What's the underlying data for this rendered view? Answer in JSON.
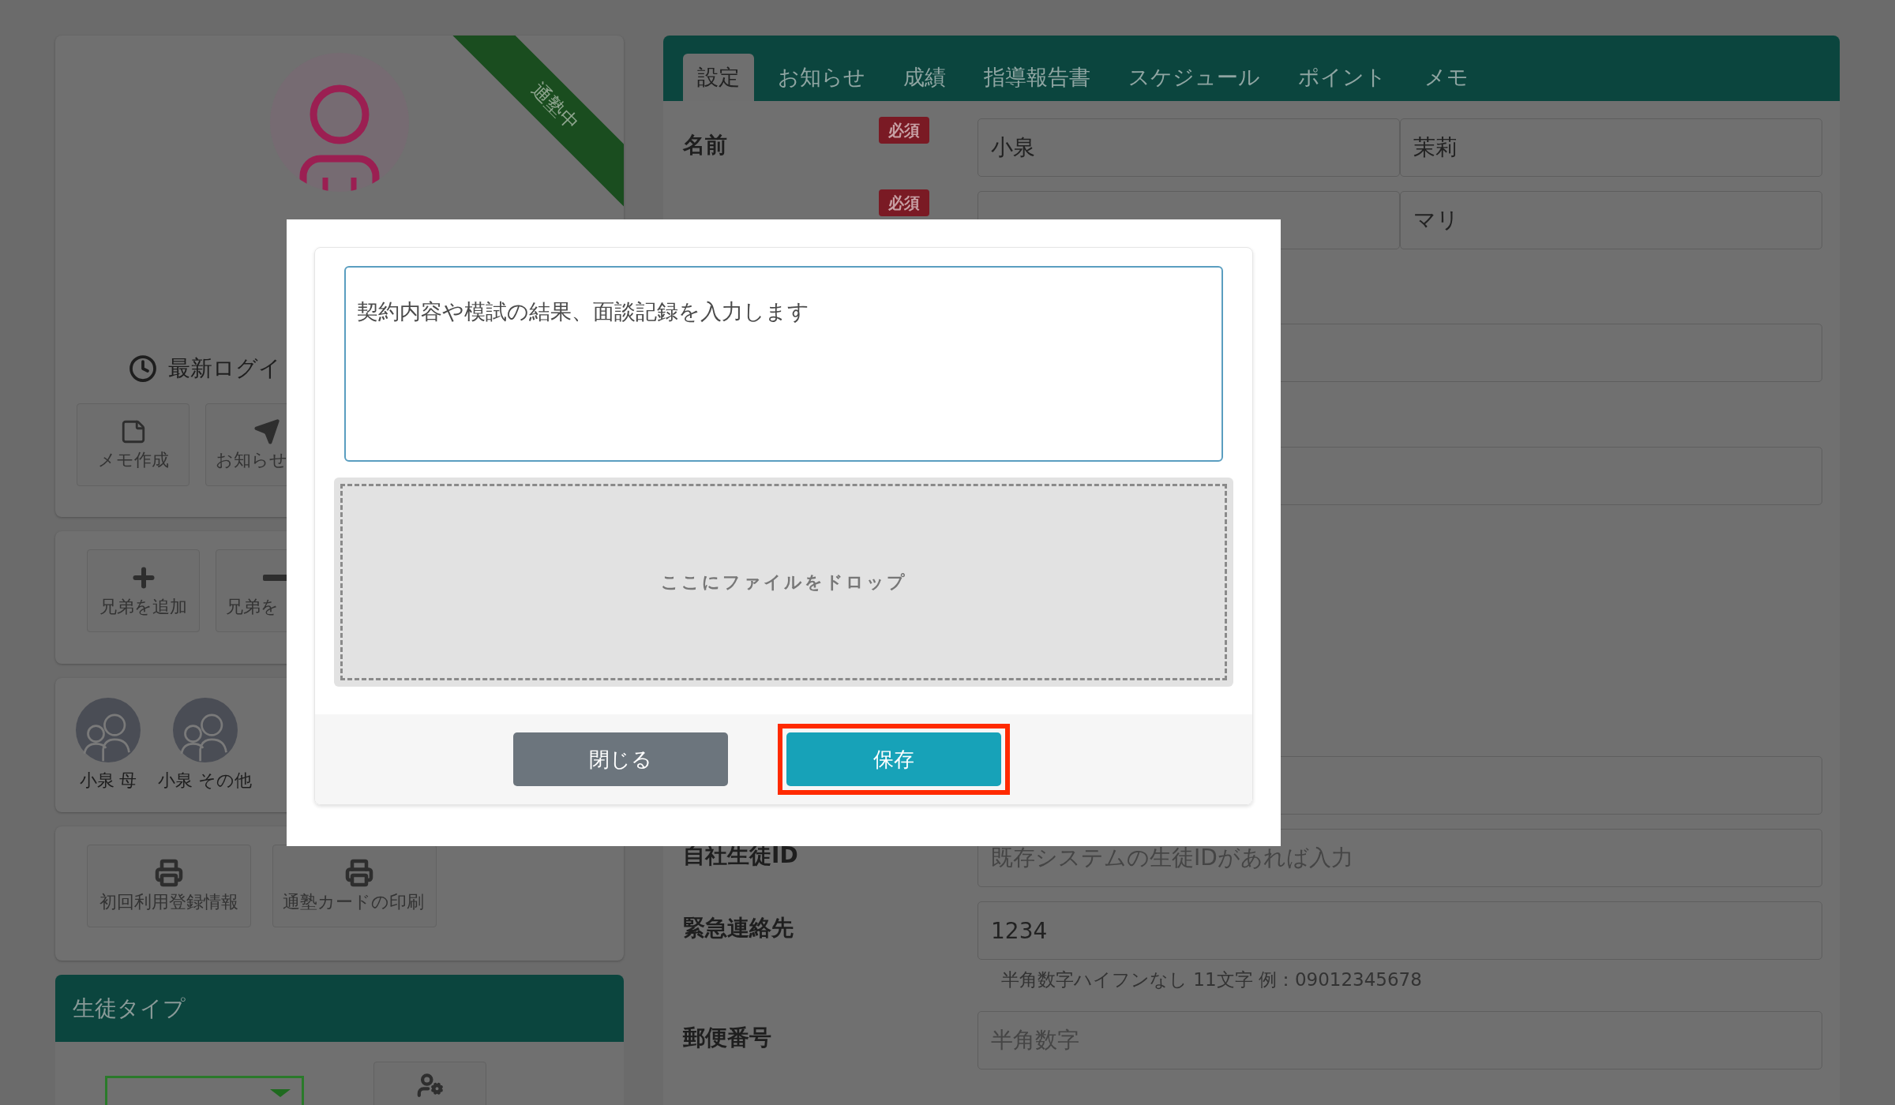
{
  "profile": {
    "ribbon": "通塾中",
    "last_login_label": "最新ログイ",
    "actions": [
      {
        "kind": "memo",
        "label": "メモ作成"
      },
      {
        "kind": "notice",
        "label": "お知らせ"
      }
    ]
  },
  "sibling_actions": [
    {
      "kind": "add",
      "label": "兄弟を追加"
    },
    {
      "kind": "remove",
      "label": "兄弟を"
    }
  ],
  "family": [
    {
      "name": "小泉 母"
    },
    {
      "name": "小泉 その他"
    }
  ],
  "print_actions": [
    "初回利用登録情報",
    "通塾カードの印刷"
  ],
  "student_type": {
    "title": "生徒タイプ"
  },
  "tabs": [
    {
      "label": "設定",
      "selected": true
    },
    {
      "label": "お知らせ",
      "selected": false
    },
    {
      "label": "成績",
      "selected": false
    },
    {
      "label": "指導報告書",
      "selected": false
    },
    {
      "label": "スケジュール",
      "selected": false
    },
    {
      "label": "ポイント",
      "selected": false
    },
    {
      "label": "メモ",
      "selected": false
    }
  ],
  "form": {
    "rows": [
      {
        "label": "名前",
        "badge": "必須",
        "fields": [
          {
            "kind": "value",
            "text": "小泉"
          },
          {
            "kind": "value",
            "text": "茉莉"
          }
        ]
      },
      {
        "badge": "必須",
        "fields": [
          {
            "kind": "blank"
          },
          {
            "kind": "value",
            "text": "マリ"
          }
        ]
      },
      {
        "fields": [
          {
            "kind": "blank"
          }
        ]
      },
      {
        "fields": [
          {
            "kind": "blank"
          }
        ]
      },
      {
        "fields": [
          {
            "kind": "blank"
          }
        ]
      },
      {
        "label": "自社生徒ID",
        "fields": [
          {
            "kind": "placeholder",
            "text": "既存システムの生徒IDがあれば入力"
          }
        ]
      },
      {
        "label": "緊急連絡先",
        "fields": [
          {
            "kind": "value",
            "text": "1234"
          }
        ],
        "hint": "半角数字ハイフンなし 11文字 例：09012345678"
      },
      {
        "label": "郵便番号",
        "fields": [
          {
            "kind": "placeholder",
            "text": "半角数字"
          }
        ]
      }
    ]
  },
  "modal": {
    "note_placeholder": "契約内容や模試の結果、面談記録を入力します",
    "dropzone": "ここにファイルをドロップ",
    "buttons": [
      {
        "kind": "close",
        "label": "閉じる",
        "highlighted": false
      },
      {
        "kind": "save",
        "label": "保存",
        "highlighted": true
      }
    ]
  }
}
